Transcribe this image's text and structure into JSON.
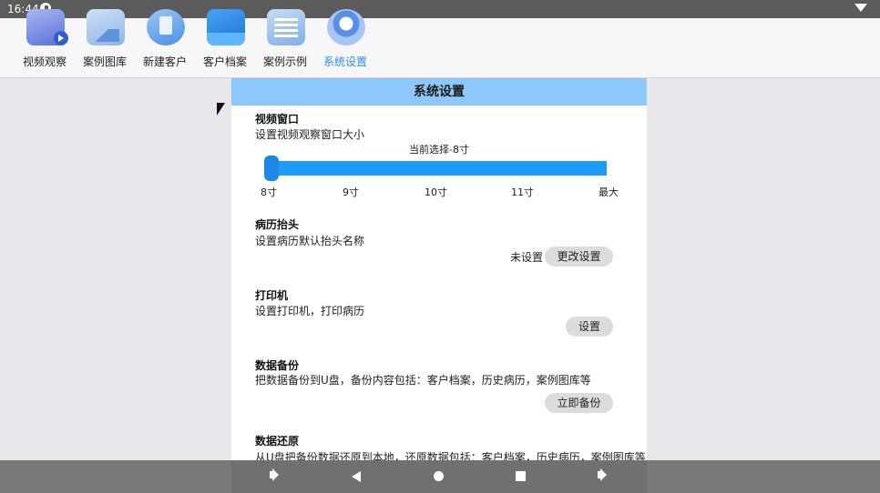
{
  "status_bar": {
    "time": "16:44"
  },
  "nav": {
    "items": [
      {
        "label": "视频观察",
        "icon": "video-observe-icon"
      },
      {
        "label": "案例图库",
        "icon": "case-gallery-icon"
      },
      {
        "label": "新建客户",
        "icon": "new-customer-icon"
      },
      {
        "label": "客户档案",
        "icon": "customer-archive-icon"
      },
      {
        "label": "案例示例",
        "icon": "case-example-icon"
      },
      {
        "label": "系统设置",
        "icon": "system-settings-icon",
        "active": true
      }
    ]
  },
  "panel": {
    "title": "系统设置",
    "video_window": {
      "title": "视频窗口",
      "desc": "设置视频观察窗口大小",
      "current": "当前选择-8寸",
      "slider_value": 0,
      "ticks": [
        "8寸",
        "9寸",
        "10寸",
        "11寸",
        "最大"
      ]
    },
    "record_header": {
      "title": "病历抬头",
      "desc": "设置病历默认抬头名称",
      "status": "未设置",
      "button": "更改设置"
    },
    "printer": {
      "title": "打印机",
      "desc": "设置打印机，打印病历",
      "button": "设置"
    },
    "backup": {
      "title": "数据备份",
      "desc": "把数据备份到U盘，备份内容包括：客户档案，历史病历，案例图库等",
      "button": "立即备份"
    },
    "restore": {
      "title": "数据还原",
      "desc": "从U盘把备份数据还原到本地，还原数据包括：客户档案，历史病历，案例图库等"
    }
  },
  "colors": {
    "header_bg": "#8ec8fa",
    "accent": "#1e9bf7",
    "active_nav": "#2f8fe8"
  }
}
